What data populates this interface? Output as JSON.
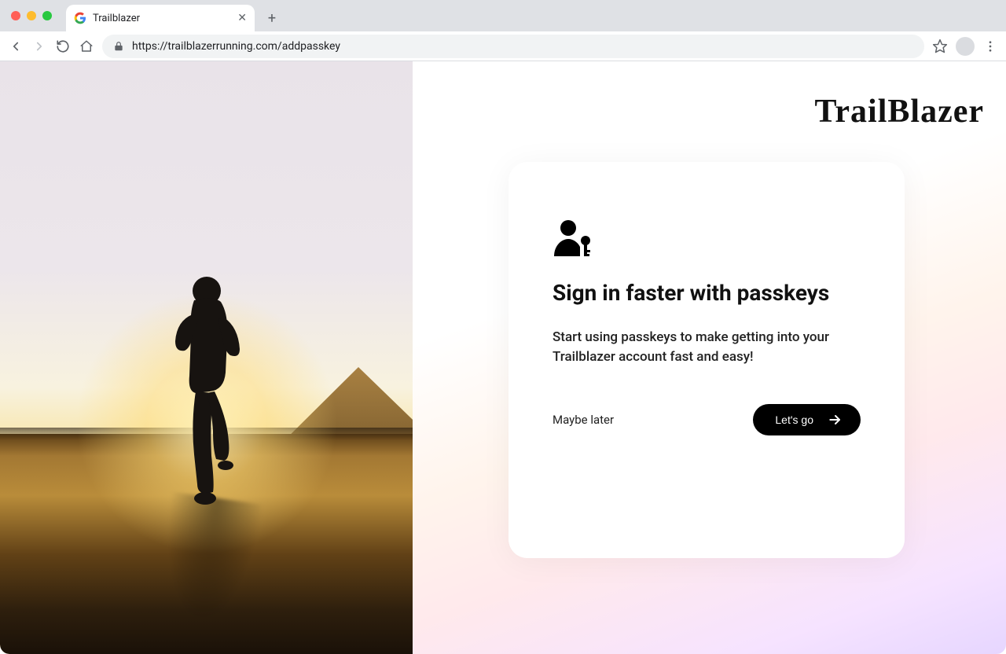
{
  "browser": {
    "tab_title": "Trailblazer",
    "url": "https://trailblazerrunning.com/addpasskey"
  },
  "brand": {
    "logo_text": "TrailBlazer"
  },
  "card": {
    "heading": "Sign in faster with passkeys",
    "body": "Start using passkeys to make getting into your Trailblazer account fast and easy!",
    "maybe_later_label": "Maybe later",
    "cta_label": "Let's go"
  }
}
